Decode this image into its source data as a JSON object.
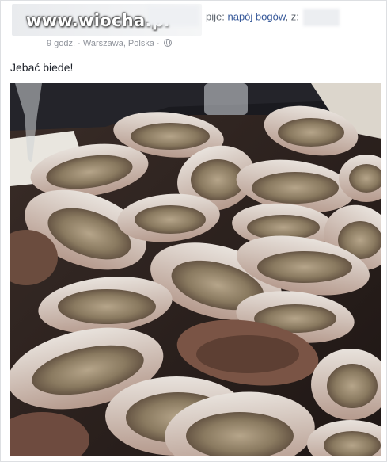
{
  "post": {
    "watermark": "www.wiocha.pl",
    "activity": {
      "prefix": "pije:",
      "drink": "napój bogów",
      "with_label": ", z:"
    },
    "meta": {
      "time": "9 godz.",
      "separator": "·",
      "location": "Warszawa, Polska",
      "privacy_icon": "globe-icon"
    },
    "text": "Jebać biede!",
    "photo": {
      "subject": "oysters-on-a-platter-icon"
    }
  },
  "colors": {
    "link": "#365899",
    "meta": "#90949c",
    "text": "#1d2129"
  }
}
